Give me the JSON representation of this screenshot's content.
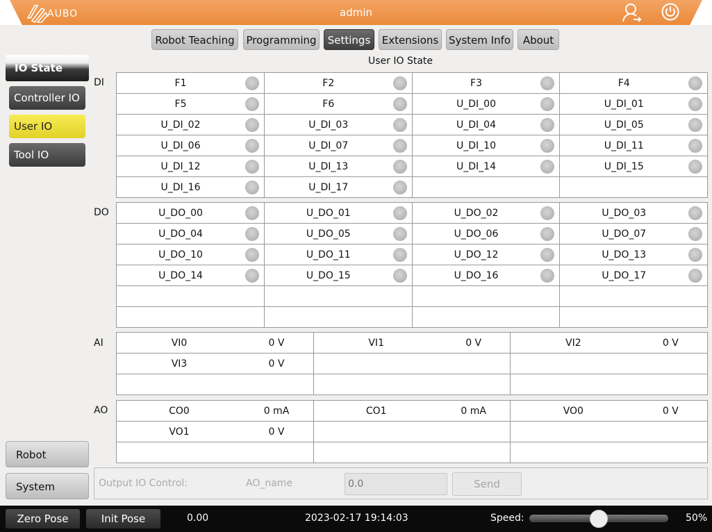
{
  "header": {
    "logo_text": "AUBO",
    "user": "admin",
    "brand_color": "#ec8f3f",
    "icons": [
      "user-icon",
      "power-icon"
    ]
  },
  "tabs": [
    {
      "label": "Robot Teaching",
      "active": false
    },
    {
      "label": "Programming",
      "active": false
    },
    {
      "label": "Settings",
      "active": true
    },
    {
      "label": "Extensions",
      "active": false
    },
    {
      "label": "System Info",
      "active": false
    },
    {
      "label": "About",
      "active": false
    }
  ],
  "sidebar": {
    "title": "IO State",
    "items": [
      {
        "label": "Controller IO",
        "active": false
      },
      {
        "label": "User IO",
        "active": true
      },
      {
        "label": "Tool IO",
        "active": false
      }
    ],
    "bottom": [
      {
        "label": "Robot"
      },
      {
        "label": "System"
      }
    ]
  },
  "page_title": "User IO State",
  "di": {
    "label": "DI",
    "rows": [
      [
        "F1",
        "F2",
        "F3",
        "F4"
      ],
      [
        "F5",
        "F6",
        "U_DI_00",
        "U_DI_01"
      ],
      [
        "U_DI_02",
        "U_DI_03",
        "U_DI_04",
        "U_DI_05"
      ],
      [
        "U_DI_06",
        "U_DI_07",
        "U_DI_10",
        "U_DI_11"
      ],
      [
        "U_DI_12",
        "U_DI_13",
        "U_DI_14",
        "U_DI_15"
      ],
      [
        "U_DI_16",
        "U_DI_17",
        "",
        ""
      ]
    ]
  },
  "do": {
    "label": "DO",
    "rows": [
      [
        "U_DO_00",
        "U_DO_01",
        "U_DO_02",
        "U_DO_03"
      ],
      [
        "U_DO_04",
        "U_DO_05",
        "U_DO_06",
        "U_DO_07"
      ],
      [
        "U_DO_10",
        "U_DO_11",
        "U_DO_12",
        "U_DO_13"
      ],
      [
        "U_DO_14",
        "U_DO_15",
        "U_DO_16",
        "U_DO_17"
      ],
      [
        "",
        "",
        "",
        ""
      ],
      [
        "",
        "",
        "",
        ""
      ]
    ]
  },
  "ai": {
    "label": "AI",
    "rows": [
      [
        {
          "name": "VI0",
          "value": "0 V"
        },
        {
          "name": "VI1",
          "value": "0 V"
        },
        {
          "name": "VI2",
          "value": "0 V"
        }
      ],
      [
        {
          "name": "VI3",
          "value": "0 V"
        },
        null,
        null
      ],
      [
        null,
        null,
        null
      ]
    ]
  },
  "ao": {
    "label": "AO",
    "rows": [
      [
        {
          "name": "CO0",
          "value": "0 mA"
        },
        {
          "name": "CO1",
          "value": "0 mA"
        },
        {
          "name": "VO0",
          "value": "0 V"
        }
      ],
      [
        {
          "name": "VO1",
          "value": "0 V"
        },
        null,
        null
      ],
      [
        null,
        null,
        null
      ]
    ]
  },
  "output_control": {
    "label": "Output IO Control:",
    "name": "AO_name",
    "value_placeholder": "0.0",
    "send_label": "Send"
  },
  "footer": {
    "zero_pose": "Zero Pose",
    "init_pose": "Init Pose",
    "value": "0.00",
    "datetime": "2023-02-17 19:14:03",
    "speed_label": "Speed:",
    "speed_value": "50%",
    "speed_fraction": 0.5
  }
}
